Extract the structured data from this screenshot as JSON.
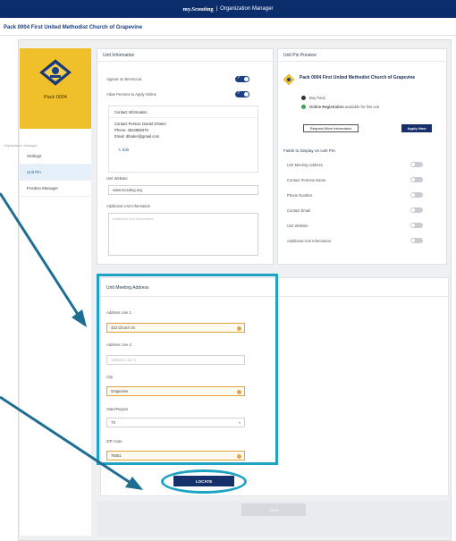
{
  "header": {
    "brand": "my.Scouting",
    "separator": "|",
    "section": "Organization Manager"
  },
  "unit_bar": {
    "title": "Pack 0004 First United Methodist Church of Grapevine"
  },
  "sidebar": {
    "pack_name": "Pack 0004",
    "section_label": "Organization Manager",
    "items": [
      {
        "label": "Settings"
      },
      {
        "label": "Unit Pin"
      },
      {
        "label": "Position Manager"
      }
    ]
  },
  "unit_info": {
    "title": "Unit Information",
    "appear_label": "Appear on BeAScout",
    "allow_label": "Allow Persons to Apply Online",
    "contact_heading": "Contact Information",
    "contact_person_label": "Contact Person:",
    "contact_person": "Daniel Gholeri",
    "phone_label": "Phone:",
    "phone": "4822859379",
    "email_label": "Email:",
    "email": "dbraleri@gmail.com",
    "edit_label": "Edit",
    "website_label": "Unit Website",
    "website_value": "www.scouting.org",
    "additional_label": "Additional Unit Information",
    "additional_placeholder": "Additional Unit Information"
  },
  "pin_preview": {
    "title": "Unit Pin Preview",
    "unit_name": "Pack 0004 First United Methodist Church of Grapevine",
    "pack_type": "Boy Pack",
    "online_reg_bold": "Online Registration",
    "online_reg_rest": "available for this unit",
    "request_button": "Request More Information",
    "apply_button": "Apply Now",
    "fields_heading": "Fields to Display on Unit Pin:",
    "fields": [
      {
        "label": "Unit Meeting Address"
      },
      {
        "label": "Contact Persons Name"
      },
      {
        "label": "Phone Number"
      },
      {
        "label": "Contact Email"
      },
      {
        "label": "Unit Website"
      },
      {
        "label": "Additional Unit Information"
      }
    ]
  },
  "meeting_address": {
    "title": "Unit Meeting Address",
    "line1_label": "Address Line 1",
    "line1_value": "422 Church St",
    "line2_label": "Address Line 2",
    "line2_placeholder": "Address Line 2",
    "city_label": "City",
    "city_value": "Grapevine",
    "state_label": "State/Region",
    "state_value": "TX",
    "zip_label": "ZIP Code",
    "zip_value": "76051"
  },
  "locate_button": "LOCATE",
  "save_button": "SAVE",
  "colors": {
    "navy": "#15306a",
    "gold": "#f0c02b",
    "annotation": "#1fa3c4",
    "online": "#2fa84f"
  }
}
